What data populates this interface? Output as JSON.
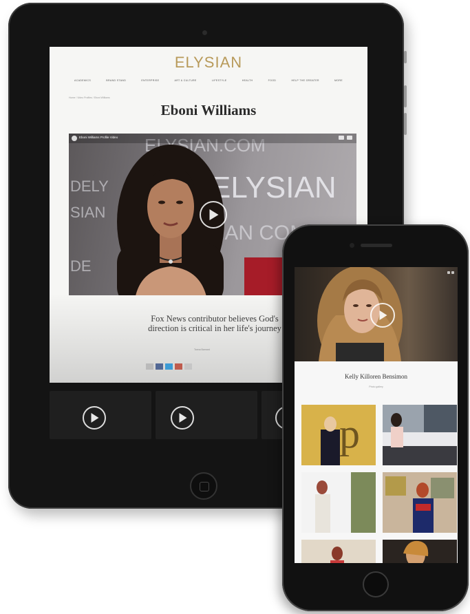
{
  "colors": {
    "brand_gold": "#b89a5a",
    "share_facebook": "#3b5998",
    "share_twitter": "#1da1f2",
    "share_google": "#d34836",
    "sofa_red": "#a61c28"
  },
  "tablet": {
    "site": {
      "logo": "ELYSIAN",
      "nav": [
        "ACADEMICS",
        "BRAND STAND",
        "ENTERPRISE",
        "ART & CULTURE",
        "LIFESTYLE",
        "HEALTH",
        "FOOD",
        "HELP THE GREATER",
        "MORE"
      ],
      "breadcrumb": "Home  /  Video Profiles  /  Eboni Williams"
    },
    "page_title": "Eboni Williams",
    "video": {
      "title": "Eboni Williams Profile Video",
      "wall_text": [
        "ELYSIAN.COM",
        "ELYSIAN",
        "DELY",
        "SIAN",
        "IAN COM",
        "DE"
      ],
      "play_icon": "play-circle-icon"
    },
    "tagline": "Fox News contributor believes God's direction is critical in her life's journey",
    "byline": "Tanna Barnard",
    "share": [
      "facebook-icon",
      "twitter-icon",
      "google-plus-icon"
    ],
    "thumbnails": [
      "play-circle-icon",
      "play-circle-icon",
      "play-circle-icon"
    ]
  },
  "phone": {
    "hero": {
      "play_icon": "play-circle-icon"
    },
    "profile_name": "Kelly Killoren Bensimon",
    "profile_sub": "Photo gallery",
    "gallery_count": 6
  }
}
